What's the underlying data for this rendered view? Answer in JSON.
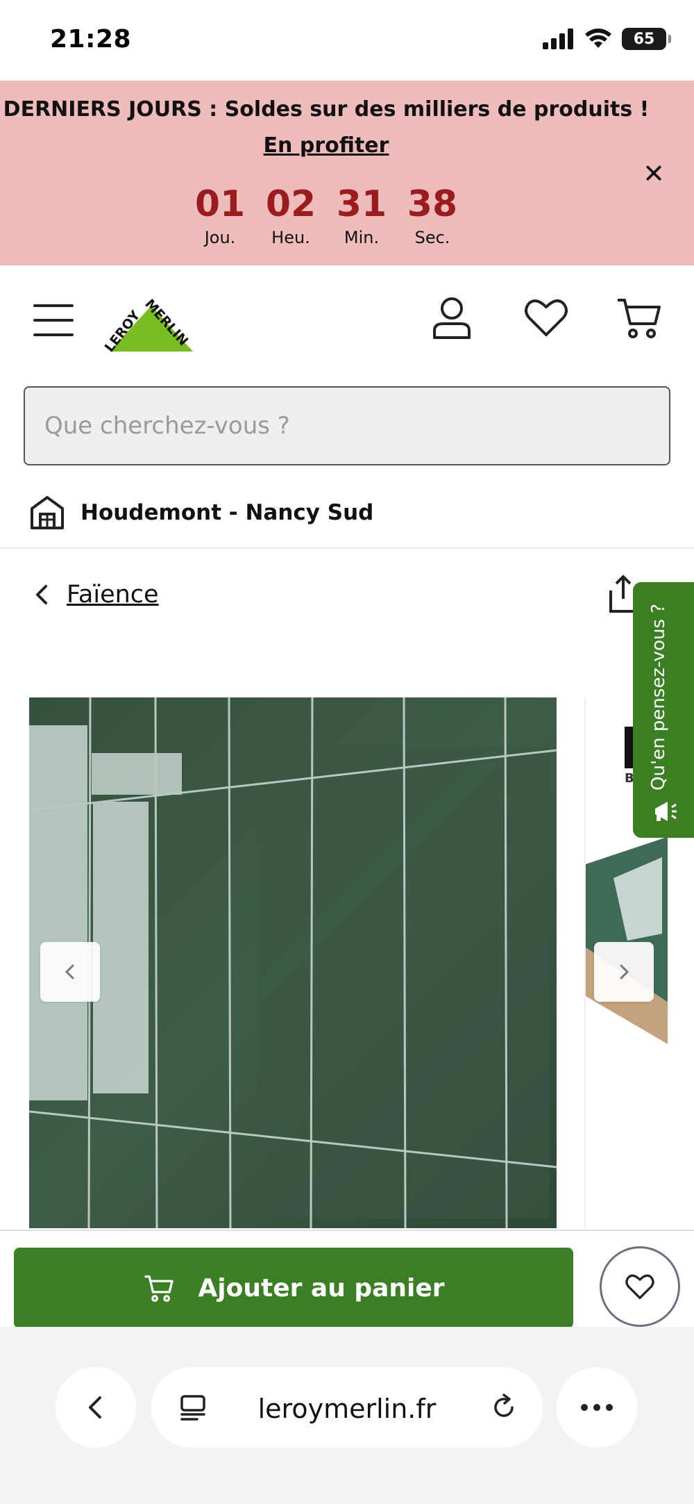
{
  "status": {
    "time": "21:28",
    "battery": "65"
  },
  "promo": {
    "message": "DERNIERS JOURS : Soldes sur des milliers de produits !",
    "link": "En profiter",
    "countdown": [
      {
        "value": "01",
        "label": "Jou."
      },
      {
        "value": "02",
        "label": "Heu."
      },
      {
        "value": "31",
        "label": "Min."
      },
      {
        "value": "38",
        "label": "Sec."
      }
    ]
  },
  "header": {
    "logo_text": "LEROY MERLIN",
    "icons": [
      "hamburger-menu-icon",
      "account-icon",
      "favorites-heart-icon",
      "cart-icon"
    ]
  },
  "search": {
    "placeholder": "Que cherchez-vous ?"
  },
  "store": {
    "name": "Houdemont - Nancy Sud"
  },
  "breadcrumb": {
    "label": "Faïence"
  },
  "feedback": {
    "label": "Qu'en pensez-vous ?"
  },
  "gallery": {
    "next_peek_logo": "B"
  },
  "actions": {
    "add_to_cart": "Ajouter au panier"
  },
  "browser": {
    "url": "leroymerlin.fr"
  },
  "colors": {
    "brand_green": "#3a7f24",
    "promo_bg": "#efbcbc",
    "countdown_red": "#9b1c1c"
  }
}
